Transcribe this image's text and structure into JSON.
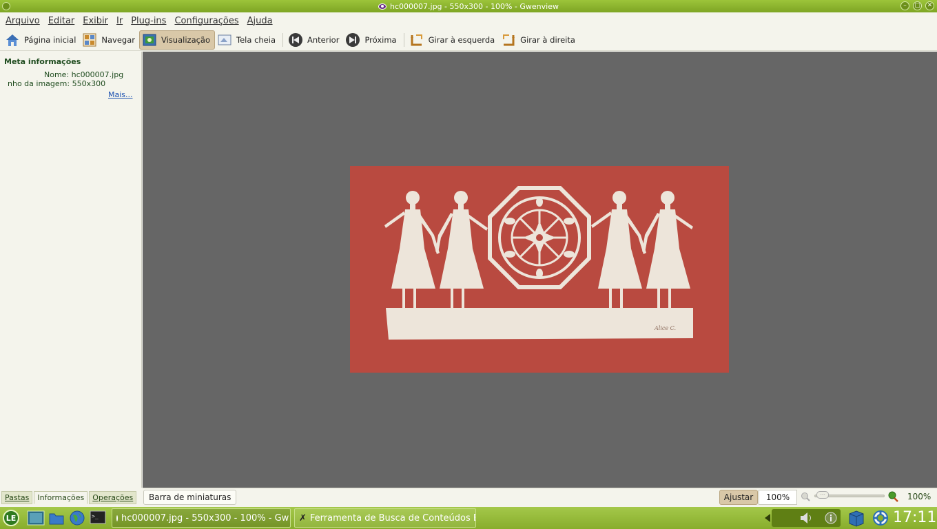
{
  "window": {
    "title": "hc000007.jpg - 550x300 - 100% - Gwenview",
    "btn_minimize": "–",
    "btn_maximize": "▢",
    "btn_close": "✕"
  },
  "menubar": {
    "items": [
      "Arquivo",
      "Editar",
      "Exibir",
      "Ir",
      "Plug-ins",
      "Configurações",
      "Ajuda"
    ]
  },
  "toolbar": {
    "home": "Página inicial",
    "browse": "Navegar",
    "view": "Visualização",
    "fullscreen": "Tela cheia",
    "previous": "Anterior",
    "next": "Próxima",
    "rotate_left": "Girar à esquerda",
    "rotate_right": "Girar à direita"
  },
  "sidebar": {
    "section_title": "Meta informações",
    "name_row": "Nome: hc000007.jpg",
    "size_row": "nho da imagem: 550x300",
    "more_link": "Mais...",
    "collapse_glyph": "‹",
    "tabs": [
      "Pastas",
      "Informações",
      "Operações"
    ]
  },
  "image": {
    "colors": {
      "background": "#b94a40",
      "paper": "#ede5da"
    },
    "signature": "Alice C."
  },
  "statusbar": {
    "thumbnail_bar": "Barra de miniaturas",
    "fit": "Ajustar",
    "zoom_field": "100%",
    "zoom_label": "100%",
    "zoom_level": 1.0
  },
  "taskbar": {
    "tasks": [
      {
        "label": "hc000007.jpg - 550x300 - 100% - Gw"
      },
      {
        "label": "Ferramenta de Busca de Conteúdos Ec"
      }
    ],
    "clock": "17:11",
    "logo": "LE"
  },
  "colors": {
    "accent_green": "#8fb432",
    "viewer_bg": "#666666",
    "active_tool": "#d9c8a8"
  }
}
